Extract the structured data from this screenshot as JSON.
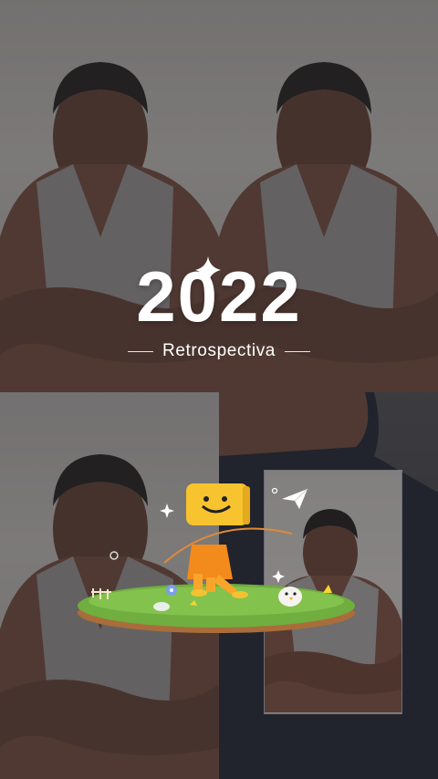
{
  "overlay": {
    "year": "2022",
    "subtitle": "Retrospectiva"
  },
  "icons": {
    "sparkle": "sparkle-icon",
    "paper_plane": "paper-plane-icon",
    "mascot": "mascot-illustration"
  },
  "colors": {
    "text": "#ffffff",
    "grass": "#6fae3f",
    "mascot_head": "#f7c32e",
    "mascot_body": "#f28a1c"
  }
}
